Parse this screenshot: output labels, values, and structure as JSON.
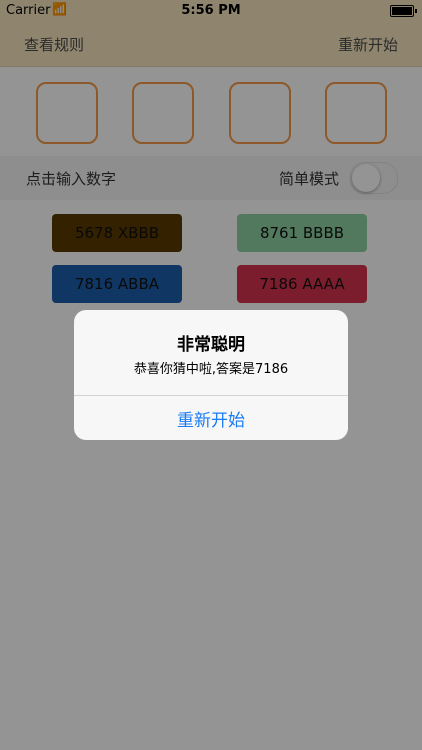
{
  "status_bar": {
    "carrier": "Carrier",
    "wifi_icon": "wifi-icon",
    "time": "5:56 PM",
    "battery_icon": "battery-icon"
  },
  "nav": {
    "left_label": "查看规则",
    "right_label": "重新开始"
  },
  "input_boxes": [
    "",
    "",
    "",
    ""
  ],
  "mode": {
    "input_label": "点击输入数字",
    "simple_label": "简单模式",
    "simple_on": false
  },
  "guesses": [
    {
      "text": "5678 XBBB",
      "color": "#5a3a00"
    },
    {
      "text": "8761 BBBB",
      "color": "#8ed1a0"
    },
    {
      "text": "7816 ABBA",
      "color": "#1d5fad"
    },
    {
      "text": "7186 AAAA",
      "color": "#d6334f"
    }
  ],
  "alert": {
    "title": "非常聪明",
    "message": "恭喜你猜中啦,答案是7186",
    "button": "重新开始"
  },
  "colors": {
    "nav_bg": "#f6e6bf",
    "input_border": "#f39a4a",
    "alert_button": "#1a7cf5"
  }
}
